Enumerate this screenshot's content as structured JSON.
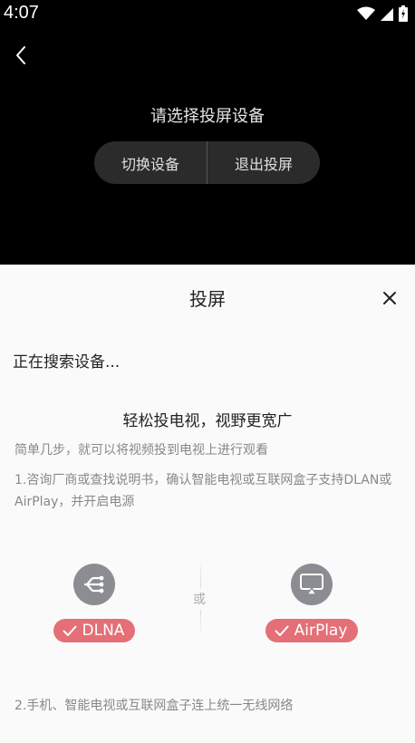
{
  "status_bar": {
    "time": "4:07",
    "icons": [
      "wifi-icon",
      "signal-icon",
      "battery-icon"
    ]
  },
  "header": {
    "back_icon": "back-chevron-icon",
    "prompt": "请选择投屏设备",
    "switch_device": "切换设备",
    "exit_cast": "退出投屏"
  },
  "sheet": {
    "title": "投屏",
    "close_icon": "close-icon",
    "searching": "正在搜索设备...",
    "headline": "轻松投电视，视野更宽广",
    "subtitle": "简单几步，就可以将视频投到电视上进行观看",
    "step1": "1.咨询厂商或查找说明书，确认智能电视或互联网盒子支持DLAN或AirPlay，并开启电源",
    "or_label": "或",
    "options": [
      {
        "label": "DLNA",
        "icon": "share-icon"
      },
      {
        "label": "AirPlay",
        "icon": "airplay-icon"
      }
    ],
    "step2": "2.手机、智能电视或互联网盒子连上统一无线网络"
  },
  "colors": {
    "badge": "#e46f76",
    "icon_circle": "#8b8d92",
    "sheet_bg": "#fafafa"
  }
}
